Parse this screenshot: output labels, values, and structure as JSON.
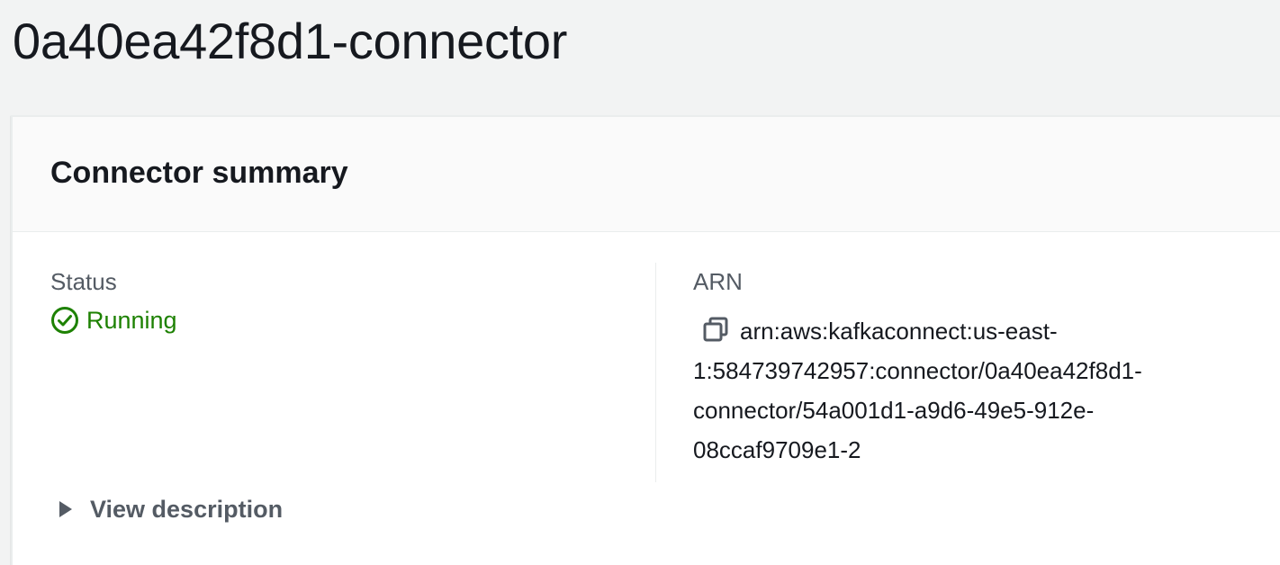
{
  "page": {
    "title": "0a40ea42f8d1-connector"
  },
  "summary": {
    "title": "Connector summary",
    "status": {
      "label": "Status",
      "value": "Running",
      "icon": "check-circle-icon",
      "color": "#1d8102"
    },
    "arn": {
      "label": "ARN",
      "lines": [
        "arn:aws:kafkaconnect:us-east-",
        "1:584739742957:connector/0a40ea42f8d1-",
        "connector/54a001d1-a9d6-49e5-912e-",
        "08ccaf9709e1-2"
      ],
      "copy_icon": "copy-icon"
    },
    "expander": {
      "label": "View description",
      "icon": "caret-right-icon"
    }
  },
  "colors": {
    "background": "#f2f3f3",
    "panel": "#ffffff",
    "header": "#fafafa",
    "success": "#1d8102",
    "label": "#545b64",
    "text": "#16191f"
  }
}
